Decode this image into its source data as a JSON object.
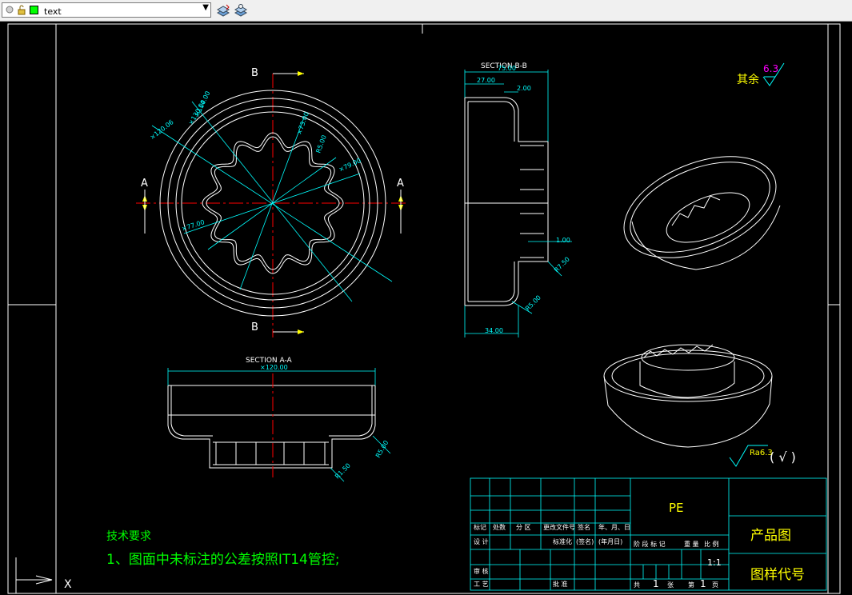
{
  "toolbar": {
    "layer_name": "text",
    "icons": [
      "light-bulb-icon",
      "sun-icon",
      "lock-icon",
      "color-swatch-icon",
      "dropdown-arrow-icon",
      "layer-previous-icon",
      "layer-manager-icon"
    ]
  },
  "drawing": {
    "top_view": {
      "section_b_top": "B",
      "section_b_bottom": "B",
      "section_a_left": "A",
      "section_a_right": "A",
      "dims": [
        "×130.00",
        "×120.06",
        "×114.00",
        "×73.00",
        "×79.00",
        "R5.00",
        "×77.00"
      ]
    },
    "section_bb": {
      "title": "SECTION  B-B",
      "dims": [
        "75.00",
        "27.00",
        "2.00",
        "1.00",
        "R7.50",
        "R5.00",
        "34.00"
      ]
    },
    "section_aa": {
      "title": "SECTION  A-A",
      "dims": [
        "×120.00",
        "R5.00",
        "R1.50"
      ]
    },
    "roughness": {
      "label_other": "其余",
      "value": "6.3",
      "ra_label": "Ra6.3",
      "ra_paren": "( √ )"
    },
    "notes": {
      "heading": "技术要求",
      "line1": "1、图面中未标注的公差按照IT14管控;"
    },
    "title_block": {
      "material": "PE",
      "product_drawing": "产品图",
      "drawing_number": "图样代号",
      "scale": "1:1",
      "r_mark": "标记",
      "r_count": "处数",
      "r_zone": "分 区",
      "r_docno": "更改文件号",
      "r_sign": "签名",
      "r_date": "年、月、日",
      "design": "设 计",
      "standard": "标准化",
      "sign_paren": "(签名)",
      "date_paren": "(年月日)",
      "stage": "阶 段 标 记",
      "weight": "重 量",
      "ratio": "比 例",
      "review": "审 核",
      "process": "工 艺",
      "approve": "批 准",
      "total": "共",
      "total_n": "1",
      "sheets": "张",
      "sheet_no": "第",
      "sheet_n": "1",
      "page": "页"
    },
    "ucs": {
      "x_label": "X"
    }
  },
  "colors": {
    "background": "#000000",
    "outline": "#ffffff",
    "dim": "#00ffff",
    "center": "#ff0000",
    "text_green": "#00ff00",
    "text_yellow": "#ffff00",
    "magenta": "#ff00ff"
  }
}
